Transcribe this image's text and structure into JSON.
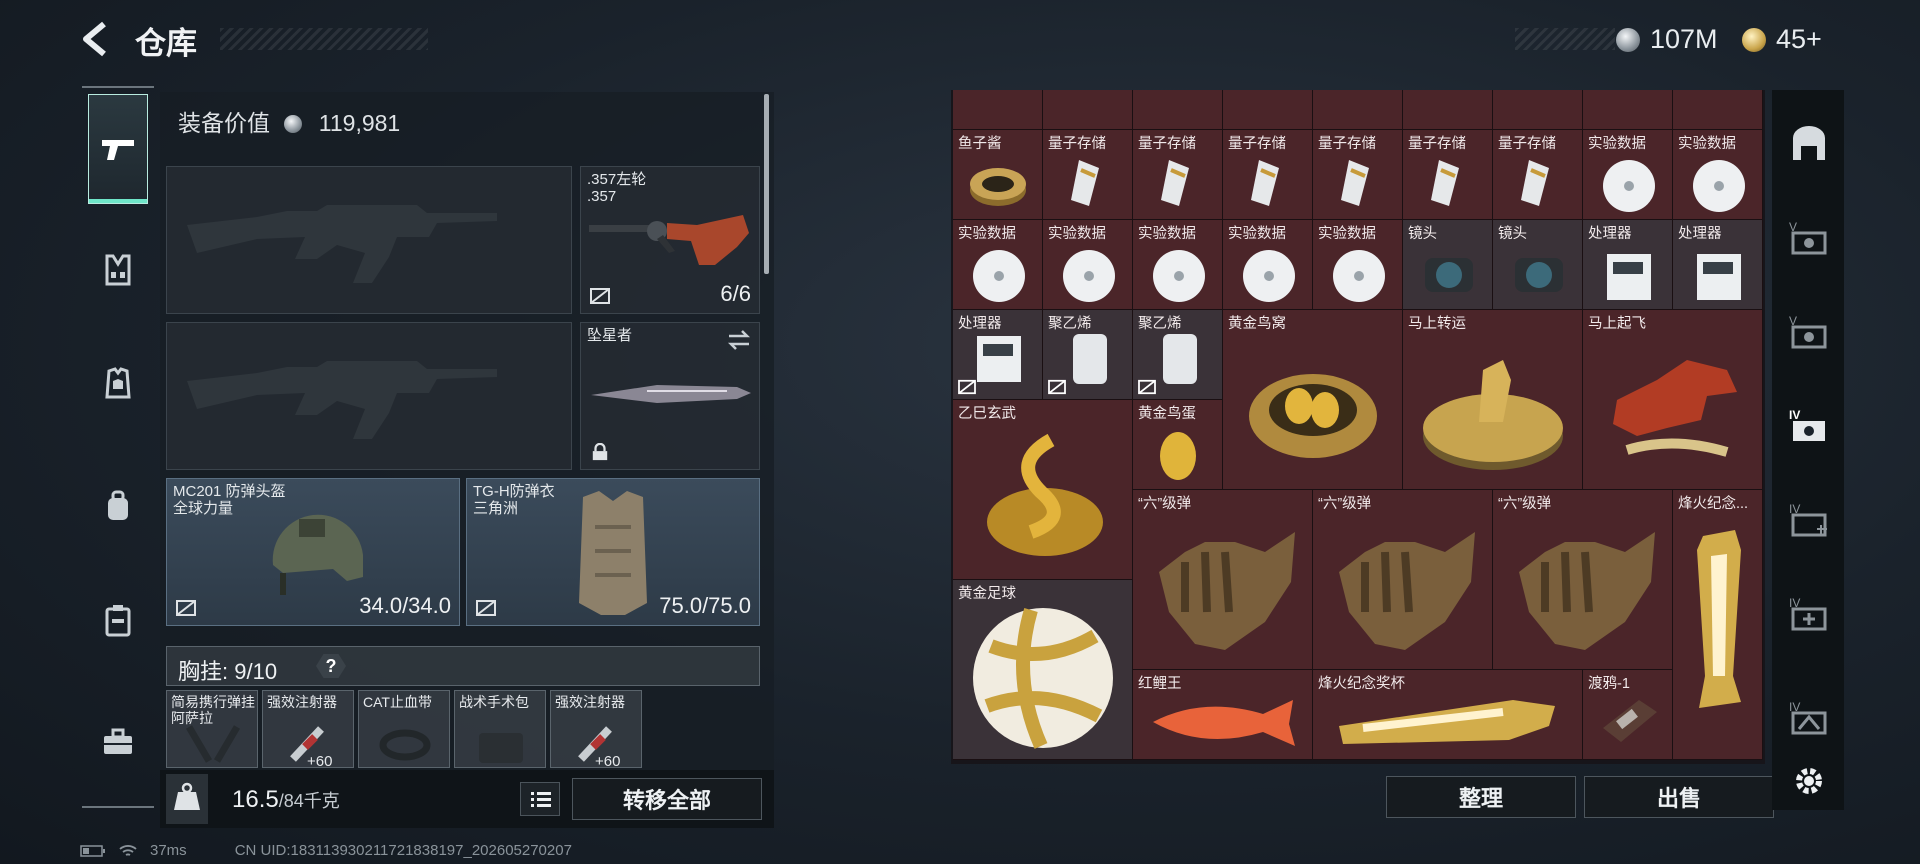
{
  "header": {
    "title": "仓库",
    "silver_amount": "107M",
    "gold_amount": "45+"
  },
  "equipment": {
    "value_label": "装备价值",
    "value": "119,981",
    "sidearm": {
      "name": ".357左轮",
      "ammo": ".357",
      "count": "6/6"
    },
    "melee": {
      "name": "坠星者"
    },
    "helmet": {
      "name": "MC201 防弹头盔",
      "faction": "全球力量",
      "durability": "34.0/34.0"
    },
    "armor": {
      "name": "TG-H防弹衣",
      "faction": "三角洲",
      "durability": "75.0/75.0"
    },
    "chest_rig_label": "胸挂:",
    "chest_rig_count": "9/10",
    "help_mark": "?",
    "rig_items": [
      {
        "label": "简易携行弹挂\n阿萨拉"
      },
      {
        "label": "强效注射器",
        "sub": "+60"
      },
      {
        "label": "CAT止血带"
      },
      {
        "label": "战术手术包"
      },
      {
        "label": "强效注射器",
        "sub": "+60"
      }
    ]
  },
  "bottom": {
    "weight": "16.5",
    "weight_max": "/84千克",
    "transfer_all": "转移全部"
  },
  "stash": {
    "sort_button": "整理",
    "sell_button": "出售",
    "row1_labels": [
      "鱼子酱",
      "量子存储",
      "量子存储",
      "量子存储",
      "量子存储",
      "量子存储",
      "量子存储",
      "实验数据",
      "实验数据"
    ],
    "row2_labels": [
      "实验数据",
      "实验数据",
      "实验数据",
      "实验数据",
      "实验数据",
      "镜头",
      "镜头",
      "处理器",
      "处理器"
    ],
    "row3_labels": [
      "处理器",
      "聚乙烯",
      "聚乙烯"
    ],
    "big": {
      "golden_nest": "黄金鸟窝",
      "horse_fortune": "马上转运",
      "horse_fly": "马上起飞",
      "xuanwu": "乙巳玄武",
      "golden_egg": "黄金鸟蛋",
      "ammo6_a": "“六”级弹",
      "ammo6_b": "“六”级弹",
      "ammo6_c": "“六”级弹",
      "trophy_tall": "烽火纪念...",
      "golden_ball": "黄金足球",
      "red_carp": "红鲤王",
      "trophy_wide": "烽火纪念奖杯",
      "raven": "渡鸦-1"
    }
  },
  "status": {
    "ping": "37ms",
    "uid": "CN UID:18311393021172183​8197_202605270207"
  },
  "colors": {
    "accent": "#6fe6c9",
    "stash_cell": "#4b2529",
    "panel": "#17151a"
  }
}
